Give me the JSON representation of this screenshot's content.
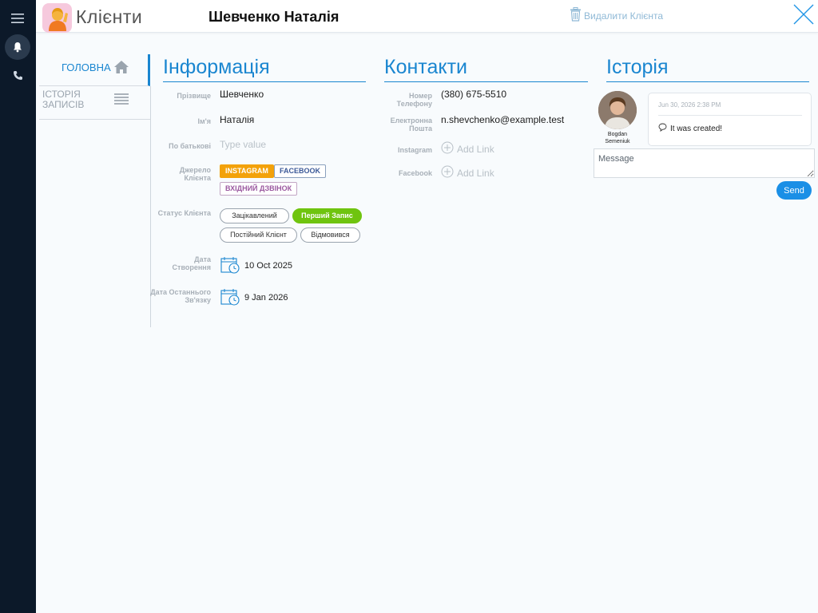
{
  "app": {
    "title": "Клієнти"
  },
  "client": {
    "full_name": "Шевченко Наталія"
  },
  "toolbar": {
    "delete_label": "Видалити Клієнта"
  },
  "tabs": {
    "home": "ГОЛОВНА",
    "history": "ІСТОРІЯ ЗАПИСІВ"
  },
  "sections": {
    "info": "Інформація",
    "contacts": "Контакти",
    "history": "Історія"
  },
  "info": {
    "surname_label": "Прізвище",
    "surname": "Шевченко",
    "name_label": "Ім'я",
    "name": "Наталія",
    "patronymic_label": "По батькові",
    "patronymic_placeholder": "Type value",
    "source_label": "Джерело Клієнта",
    "sources": [
      "INSTAGRAM",
      "FACEBOOK",
      "ВХІДНИЙ ДЗВІНОК"
    ],
    "status_label": "Статус Клієнта",
    "statuses": [
      "Зацікавлений",
      "Перший Запис",
      "Постійний Клієнт",
      "Відмовився"
    ],
    "active_status": "Перший Запис",
    "created_label": "Дата Створення",
    "created": "10 Oct 2025",
    "last_contact_label": "Дата Останнього Зв'язку",
    "last_contact": "9 Jan 2026"
  },
  "contacts": {
    "phone_label": "Номер Телефону",
    "phone": "(380) 675-5510",
    "email_label": "Електронна Пошта",
    "email": "n.shevchenko@example.test",
    "instagram_label": "Instagram",
    "instagram_action": "Add Link",
    "facebook_label": "Facebook",
    "facebook_action": "Add Link"
  },
  "history": {
    "author": "Bogdan Semeniuk",
    "entry_time": "Jun 30, 2026 2:38 PM",
    "entry_text": "It was created!",
    "message_placeholder": "Message",
    "send_label": "Send"
  },
  "colors": {
    "accent": "#1a86d0",
    "rail": "#0c1929",
    "active_status": "#6fc40f",
    "instagram": "#f3a20a",
    "facebook": "#3b5998",
    "incoming_call": "#9b59a0"
  },
  "icons": [
    "menu-icon",
    "bell-icon",
    "phone-icon",
    "app-client-icon",
    "trash-icon",
    "close-icon",
    "home-icon",
    "list-icon",
    "calendar-clock-icon",
    "plus-circle-icon",
    "chat-bubble-icon"
  ]
}
